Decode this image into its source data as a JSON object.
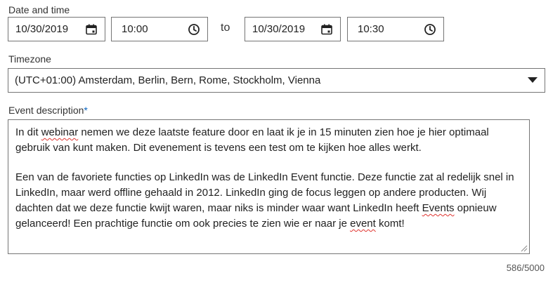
{
  "date_time": {
    "label": "Date and time",
    "start_date": "10/30/2019",
    "start_time": "10:00",
    "separator": "to",
    "end_date": "10/30/2019",
    "end_time": "10:30"
  },
  "timezone": {
    "label": "Timezone",
    "value": "(UTC+01:00) Amsterdam, Berlin, Bern, Rome, Stockholm, Vienna"
  },
  "description": {
    "label": "Event description",
    "required_marker": "*",
    "p1_s1": "In dit ",
    "p1_w1": "webinar",
    "p1_s2": " nemen we deze laatste feature door en laat ik je in 15 minuten zien hoe je hier optimaal gebruik van kunt maken. Dit evenement is tevens een test om te kijken hoe alles werkt.",
    "p2_s1": "Een van de favoriete functies op LinkedIn was de LinkedIn Event functie. Deze functie zat al redelijk snel in LinkedIn, maar werd offline gehaald in 2012. LinkedIn ging de focus leggen op andere producten. Wij dachten dat we deze functie kwijt waren, maar niks is minder waar want LinkedIn heeft ",
    "p2_w1": "Events",
    "p2_s2": " opnieuw gelanceerd! Een prachtige functie om ook precies te zien wie er naar je ",
    "p2_w2": "event",
    "p2_s3": " komt!"
  },
  "counter": "586/5000",
  "icons": {
    "date": "calendar-icon",
    "time": "clock-icon",
    "dropdown": "caret-down-icon"
  },
  "colors": {
    "required": "#0a66c2",
    "spellcheck": "#e0342f",
    "border": "#757575"
  }
}
